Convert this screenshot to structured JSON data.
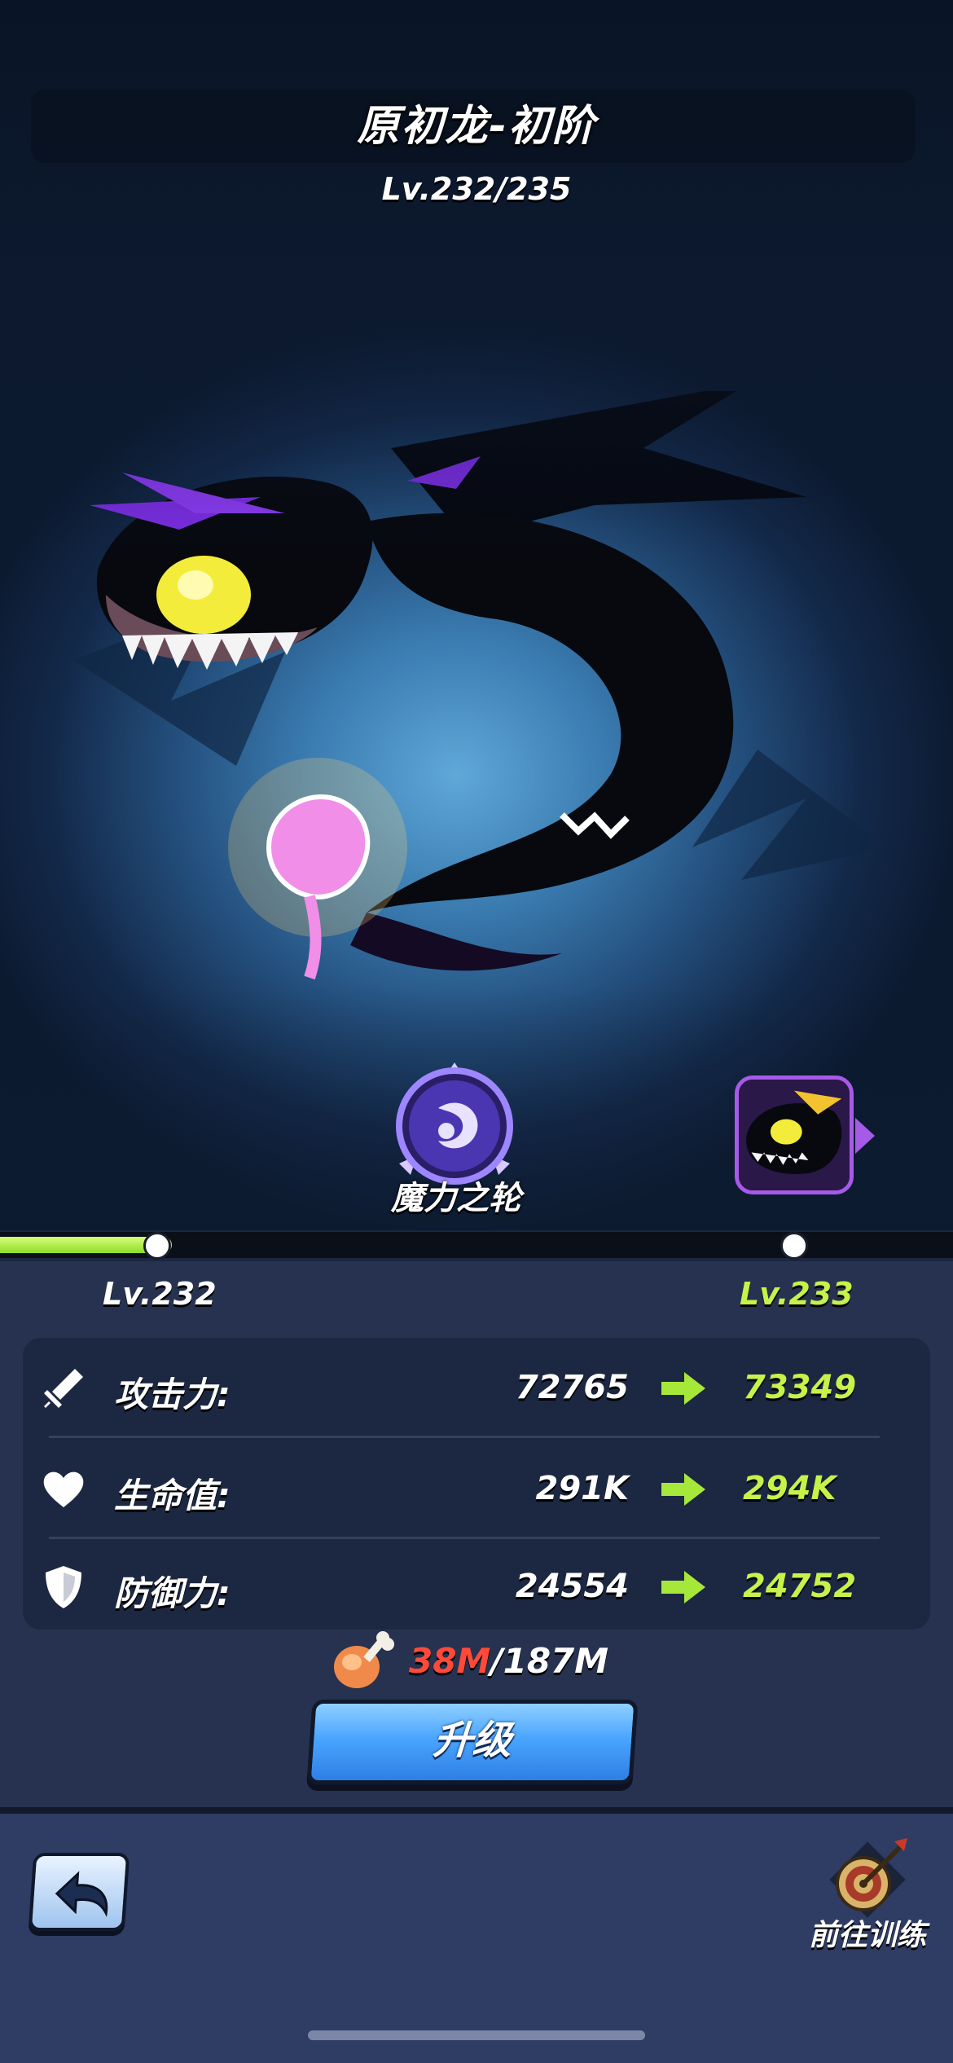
{
  "header": {
    "title": "原初龙-初阶",
    "level_cap": "Lv.232/235"
  },
  "skill": {
    "name": "魔力之轮",
    "icon": "magic-wheel-icon"
  },
  "next_form": {
    "icon": "dragon-portrait-icon"
  },
  "progress": {
    "fill_fraction": 0.18,
    "current_level": "Lv.232",
    "next_level": "Lv.233"
  },
  "stats": [
    {
      "icon": "sword-icon",
      "label": "攻击力:",
      "current": "72765",
      "next": "73349"
    },
    {
      "icon": "heart-icon",
      "label": "生命值:",
      "current": "291K",
      "next": "294K"
    },
    {
      "icon": "shield-icon",
      "label": "防御力:",
      "current": "24554",
      "next": "24752"
    }
  ],
  "cost": {
    "icon": "meat-icon",
    "have": "38M",
    "separator": "/",
    "need": "187M"
  },
  "upgrade_button": {
    "label": "升级"
  },
  "footer": {
    "back_icon": "back-arrow-icon",
    "train_icon": "target-icon",
    "train_label": "前往训练"
  },
  "colors": {
    "accent_green": "#c6f24a",
    "cost_red": "#ff4a3a",
    "button_blue": "#4aa5ff",
    "panel_bg": "#26324f",
    "footer_bg": "#2f3c64"
  }
}
